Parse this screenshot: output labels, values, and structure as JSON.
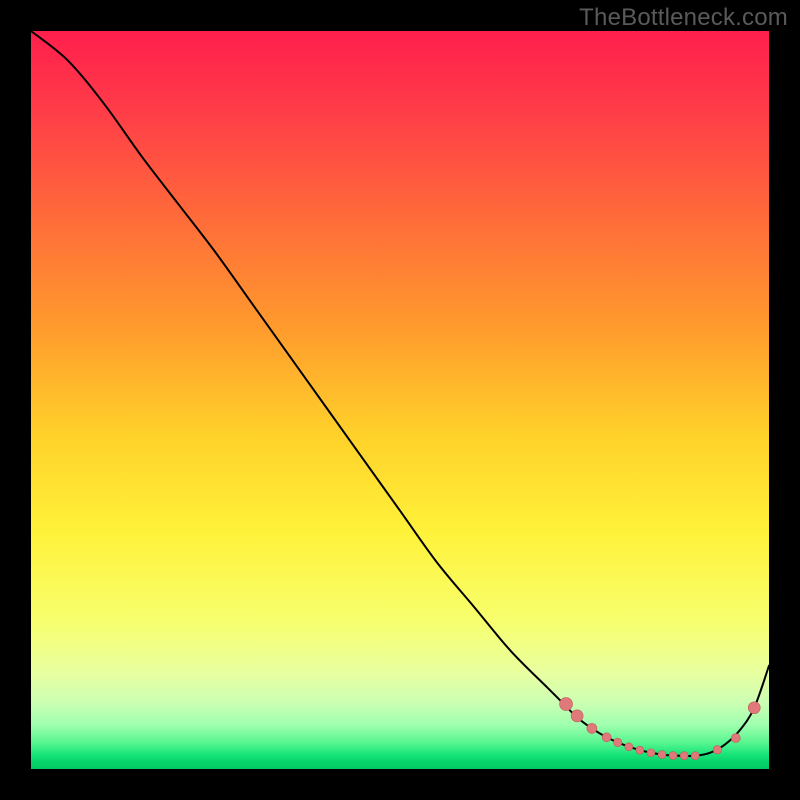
{
  "watermark": "TheBottleneck.com",
  "colors": {
    "curve_stroke": "#000000",
    "dot_fill": "#e07a7a",
    "dot_stroke": "#c45858",
    "background_top": "#ff1f4c",
    "background_bottom": "#02c862"
  },
  "chart_data": {
    "type": "line",
    "title": "",
    "xlabel": "",
    "ylabel": "",
    "xlim": [
      0,
      100
    ],
    "ylim": [
      0,
      100
    ],
    "origin_note": "greens (low y) at bottom, reds (high y) at top",
    "series": [
      {
        "name": "bottleneck-curve",
        "x": [
          0,
          5,
          10,
          15,
          20,
          25,
          30,
          35,
          40,
          45,
          50,
          55,
          60,
          65,
          70,
          72,
          74,
          76,
          78,
          80,
          82,
          84,
          86,
          88,
          90,
          92,
          94,
          96,
          98,
          100
        ],
        "y": [
          100,
          96,
          90,
          83,
          76.5,
          70,
          63,
          56,
          49,
          42,
          35,
          28,
          22,
          16,
          11,
          9,
          7,
          5.5,
          4.3,
          3.4,
          2.7,
          2.2,
          1.9,
          1.8,
          1.8,
          2.2,
          3.3,
          5.2,
          8.3,
          14
        ]
      }
    ],
    "markers": {
      "name": "highlight-dots",
      "x": [
        72.5,
        74,
        76,
        78,
        79.5,
        81,
        82.5,
        84,
        85.5,
        87,
        88.5,
        90,
        93,
        95.5,
        98
      ],
      "y": [
        8.8,
        7.2,
        5.5,
        4.3,
        3.6,
        3.0,
        2.55,
        2.2,
        1.95,
        1.82,
        1.8,
        1.8,
        2.6,
        4.2,
        8.3
      ],
      "size": [
        6.5,
        6,
        5,
        4.5,
        4.2,
        4,
        4,
        4,
        4,
        4,
        4,
        4,
        4.2,
        4.5,
        6
      ]
    }
  }
}
